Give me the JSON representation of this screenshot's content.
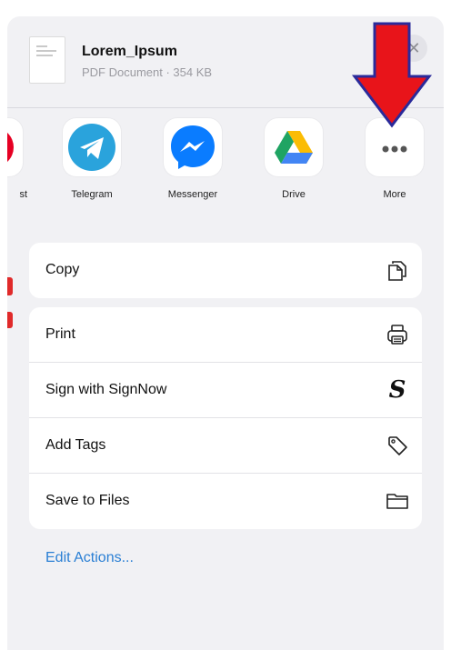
{
  "document": {
    "title": "Lorem_Ipsum",
    "subtitle": "PDF Document · 354 KB"
  },
  "apps": [
    {
      "label": "st",
      "icon": "pinterest-icon"
    },
    {
      "label": "Telegram",
      "icon": "telegram-icon",
      "color": "#2aa3dc"
    },
    {
      "label": "Messenger",
      "icon": "messenger-icon",
      "color": "#0a7cff"
    },
    {
      "label": "Drive",
      "icon": "google-drive-icon"
    },
    {
      "label": "More",
      "icon": "more-dots-icon"
    }
  ],
  "actions": {
    "copy": "Copy",
    "print": "Print",
    "sign": "Sign with SignNow",
    "tags": "Add Tags",
    "files": "Save to Files"
  },
  "edit_actions": "Edit Actions...",
  "colors": {
    "sheet_bg": "#f1f1f4",
    "link_blue": "#2a7fd4",
    "arrow_red": "#e8141a",
    "arrow_outline": "#2a2a9a"
  }
}
